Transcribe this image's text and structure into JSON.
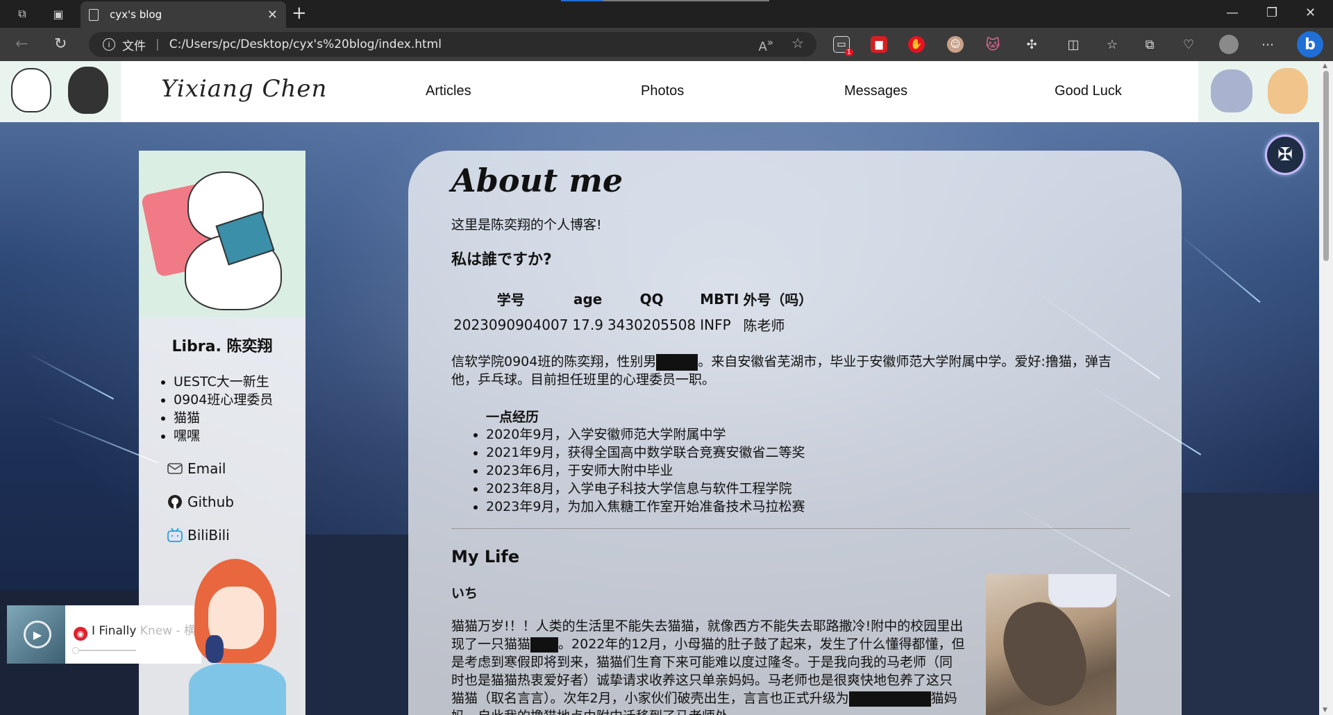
{
  "browser": {
    "tab_title": "cyx's blog",
    "address_label": "文件",
    "address_url": "C:/Users/pc/Desktop/cyx's%20blog/index.html",
    "extension_badge": "1",
    "window_controls": {
      "minimize": "—",
      "restore": "❐",
      "close": "✕"
    }
  },
  "header": {
    "brand": "Yixiang Chen",
    "menu": [
      "Articles",
      "Photos",
      "Messages",
      "Good Luck"
    ]
  },
  "profile": {
    "name": "Libra. 陈奕翔",
    "tags": [
      "UESTC大一新生",
      "0904班心理委员",
      "猫猫",
      "嘿嘿"
    ],
    "links": [
      {
        "label": "Email",
        "icon": "mail-icon"
      },
      {
        "label": "Github",
        "icon": "github-icon"
      },
      {
        "label": "BiliBili",
        "icon": "bilibili-icon"
      }
    ]
  },
  "main": {
    "title": "About me",
    "intro": "这里是陈奕翔的个人博客!",
    "who_heading": "私は誰ですか?",
    "info_table": {
      "headers": [
        "学号",
        "age",
        "QQ",
        "MBTI",
        "外号（吗）"
      ],
      "values": [
        "2023090904007",
        "17.9",
        "3430205508",
        "INFP",
        "陈老师"
      ]
    },
    "bio_before": "信软学院0904班的陈奕翔，性别男",
    "bio_after": "。来自安徽省芜湖市，毕业于安徽师范大学附属中学。爱好:撸猫，弹吉他，乒乓球。目前担任班里的心理委员一职。",
    "experience_title": "一点经历",
    "experience": [
      "2020年9月，入学安徽师范大学附属中学",
      "2021年9月，获得全国高中数学联合竞赛安徽省二等奖",
      "2023年6月，于安师大附中毕业",
      "2023年8月，入学电子科技大学信息与软件工程学院",
      "2023年9月，为加入焦糖工作室开始准备技术马拉松赛"
    ],
    "mylife_heading": "My Life",
    "ichi_heading": "いち",
    "life_p1": "猫猫万岁!！！人类的生活里不能失去猫猫，就像西方不能失去耶路撒冷!附中的校园里出现了一只猫猫",
    "life_p2": "。2022年的12月，小母猫的肚子鼓了起来，发生了什么懂得都懂，但是考虑到寒假即将到来，猫猫们生育下来可能难以度过隆冬。于是我向我的马老师（同时也是猫猫热衷爱好者）诚挚请求收养这只单亲妈妈。马老师也是很爽快地包养了这只猫猫（取名言言）。次年2月，小家伙们破壳出生，言言也正式升级为",
    "life_p3": "猫妈妈。自此我的撸猫地点由附中迁移到了马老师处。"
  },
  "player": {
    "song": "I Finally",
    "song_rest": "Knew - 横"
  },
  "colors": {
    "accent_blue": "#1f6fd6",
    "tab_indicator": "#1f6fd6"
  }
}
